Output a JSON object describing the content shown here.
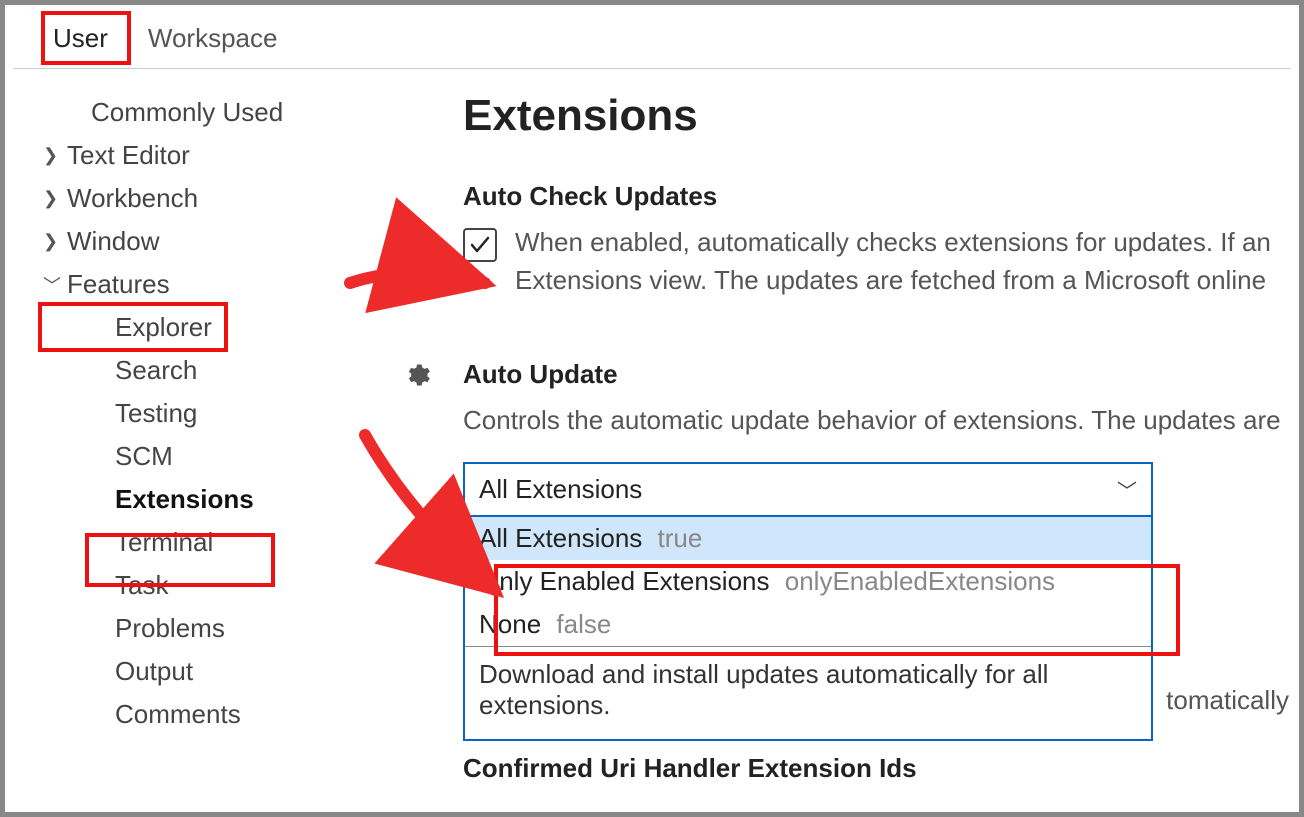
{
  "tabs": {
    "user": "User",
    "workspace": "Workspace"
  },
  "tree": {
    "commonly_used": "Commonly Used",
    "text_editor": "Text Editor",
    "workbench": "Workbench",
    "window": "Window",
    "features": "Features",
    "explorer": "Explorer",
    "search": "Search",
    "testing": "Testing",
    "scm": "SCM",
    "extensions": "Extensions",
    "terminal": "Terminal",
    "task": "Task",
    "problems": "Problems",
    "output": "Output",
    "comments": "Comments"
  },
  "main": {
    "heading": "Extensions",
    "auto_check": {
      "title": "Auto Check Updates",
      "desc": "When enabled, automatically checks extensions for updates. If an Extensions view. The updates are fetched from a Microsoft online"
    },
    "auto_update": {
      "title": "Auto Update",
      "desc": "Controls the automatic update behavior of extensions. The updates are",
      "selected": "All Extensions",
      "options": [
        {
          "label": "All Extensions",
          "hint": "true"
        },
        {
          "label": "Only Enabled Extensions",
          "hint": "onlyEnabledExtensions"
        },
        {
          "label": "None",
          "hint": "false"
        }
      ],
      "help": "Download and install updates automatically for all extensions."
    },
    "clipped_right": "tomatically",
    "cutoff_heading": "Confirmed Uri Handler Extension Ids"
  }
}
